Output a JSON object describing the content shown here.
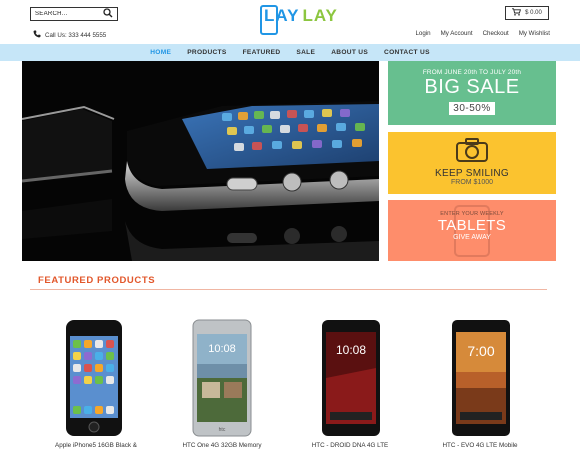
{
  "header": {
    "search_placeholder": "SEARCH...",
    "phone_text": "Call Us: 333 444 5555",
    "logo_part1": "LAY",
    "logo_part2": "LAY",
    "cart_total": "$ 0.00",
    "links": [
      "Login",
      "My Account",
      "Checkout",
      "My Wishlist"
    ]
  },
  "nav": {
    "items": [
      "HOME",
      "PRODUCTS",
      "FEATURED",
      "SALE",
      "ABOUT US",
      "CONTACT US"
    ],
    "active": "HOME"
  },
  "promos": {
    "sale": {
      "dates": "FROM JUNE 20th TO JULY 20th",
      "title": "BIG SALE",
      "percent": "30-50%"
    },
    "camera": {
      "title": "KEEP SMILING",
      "price": "FROM $1000"
    },
    "tablets": {
      "subtitle": "ENTER YOUR WEEKLY",
      "title": "TABLETS",
      "caption": "GIVE AWAY"
    }
  },
  "featured": {
    "title": "FEATURED PRODUCTS",
    "products": [
      {
        "name": "Apple iPhone5 16GB Black &",
        "screen_time": ""
      },
      {
        "name": "HTC One 4G 32GB Memory",
        "screen_time": "10:08"
      },
      {
        "name": "HTC - DROID DNA 4G LTE",
        "screen_time": "10:08"
      },
      {
        "name": "HTC - EVO 4G LTE Mobile",
        "screen_time": "7:00"
      }
    ]
  },
  "colors": {
    "accent": "#2196e5",
    "logo_green": "#8cc63f",
    "nav_bg": "#c6e6f8",
    "promo_green": "#67bf8f",
    "promo_yellow": "#fbc32f",
    "promo_orange": "#fe8d6b",
    "featured_title": "#e2572b"
  }
}
